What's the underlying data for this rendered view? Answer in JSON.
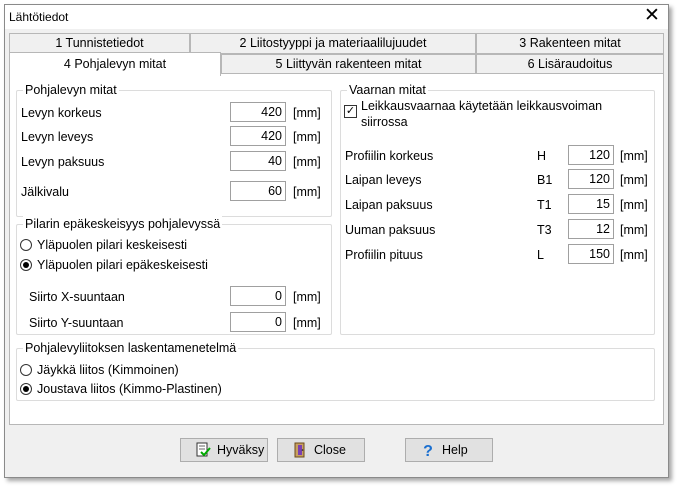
{
  "window": {
    "title": "Lähtötiedot"
  },
  "tabs_row1": [
    "1 Tunnistetiedot",
    "2 Liitostyyppi ja materiaalilujuudet",
    "3 Rakenteen mitat"
  ],
  "tabs_row2": [
    "4 Pohjalevyn mitat",
    "5 Liittyvän rakenteen mitat",
    "6 Lisäraudoitus"
  ],
  "plate": {
    "legend": "Pohjalevyn mitat",
    "height_label": "Levyn korkeus",
    "height_value": "420",
    "width_label": "Levyn leveys",
    "width_value": "420",
    "thickness_label": "Levyn paksuus",
    "thickness_value": "40",
    "grout_label": "Jälkivalu",
    "grout_value": "60",
    "unit": "[mm]"
  },
  "eccentric": {
    "legend": "Pilarin epäkeskeisyys pohjalevyssä",
    "option_centric": "Yläpuolen pilari keskeisesti",
    "option_eccentric": "Yläpuolen pilari epäkeskeisesti",
    "selected": "eccentric",
    "shift_x_label": "Siirto X-suuntaan",
    "shift_x_value": "0",
    "shift_y_label": "Siirto Y-suuntaan",
    "shift_y_value": "0",
    "unit": "[mm]"
  },
  "beam": {
    "legend": "Vaarnan mitat",
    "shear_check_label_line1": "Leikkausvaarnaa käytetään leikkausvoiman",
    "shear_check_label_line2": "siirrossa",
    "shear_checked": true,
    "height_label": "Profiilin korkeus",
    "height_sym": "H",
    "height_value": "120",
    "flange_w_label": "Laipan leveys",
    "flange_w_sym": "B1",
    "flange_w_value": "120",
    "flange_t_label": "Laipan paksuus",
    "flange_t_sym": "T1",
    "flange_t_value": "15",
    "web_t_label": "Uuman paksuus",
    "web_t_sym": "T3",
    "web_t_value": "12",
    "length_label": "Profiilin pituus",
    "length_sym": "L",
    "length_value": "150",
    "unit": "[mm]"
  },
  "method": {
    "legend": "Pohjalevyliitoksen laskentamenetelmä",
    "option_rigid": "Jäykkä liitos (Kimmoinen)",
    "option_flexible": "Joustava liitos (Kimmo-Plastinen)",
    "selected": "flexible"
  },
  "buttons": {
    "accept": "Hyväksy",
    "close": "Close",
    "help": "Help"
  },
  "icons": {
    "accept": "accept-icon",
    "close": "exit-door-icon",
    "help": "question-mark-icon"
  }
}
